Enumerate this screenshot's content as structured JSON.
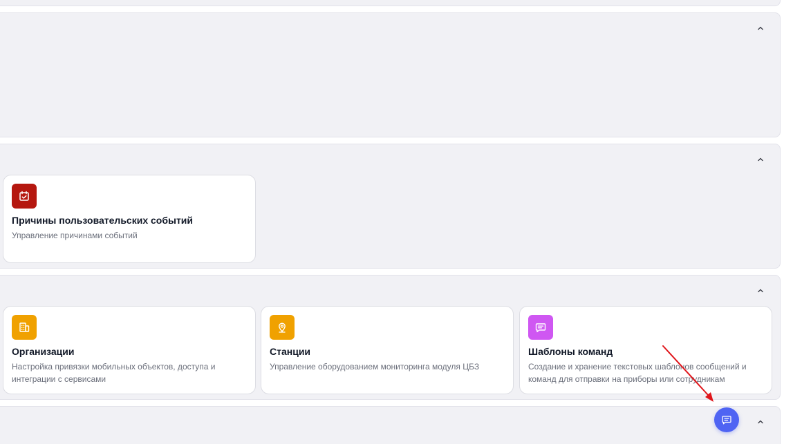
{
  "colors": {
    "section_bg": "#f1f1f5",
    "card_border": "#dcdde3",
    "icon_red": "#b5170f",
    "icon_orange": "#f0a100",
    "icon_purple": "#cf57f2",
    "fab_blue": "#4f64f3",
    "arrow_red": "#e0161b"
  },
  "sections": [
    {
      "id": "top-strip",
      "cards": []
    },
    {
      "id": "empty-section",
      "cards": []
    },
    {
      "id": "events-section",
      "cards": [
        {
          "icon": "calendar-check-icon",
          "title": "Причины пользовательских событий",
          "description": "Управление причинами событий"
        }
      ]
    },
    {
      "id": "org-section",
      "cards": [
        {
          "icon": "building-icon",
          "title": "Организации",
          "description": "Настройка привязки мобильных объектов, доступа и интеграции с сервисами"
        },
        {
          "icon": "map-pin-icon",
          "title": "Станции",
          "description": "Управление оборудованием мониторинга модуля ЦБЗ"
        },
        {
          "icon": "message-square-icon",
          "title": "Шаблоны команд",
          "description": "Создание и хранение текстовых шаблонов сообщений и команд для отправки на приборы или сотрудникам"
        }
      ]
    },
    {
      "id": "bottom-section",
      "cards": []
    }
  ],
  "fab": {
    "icon": "chat-icon"
  }
}
